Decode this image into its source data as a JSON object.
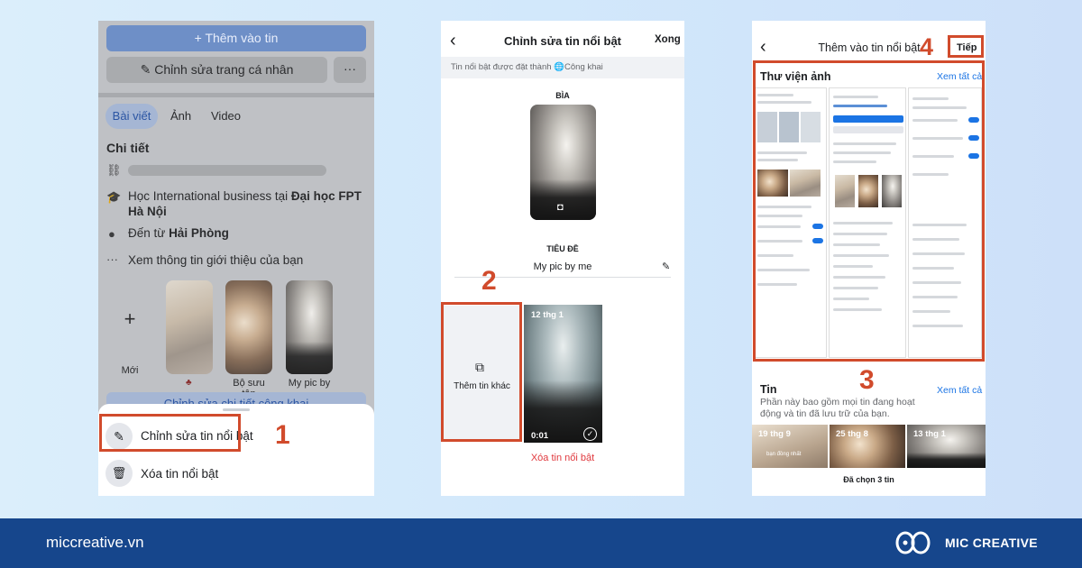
{
  "panel1": {
    "add_story_label": "Thêm vào tin",
    "edit_profile_label": "Chỉnh sửa trang cá nhân",
    "more_label": "···",
    "tabs": [
      "Bài viết",
      "Ảnh",
      "Video"
    ],
    "details_title": "Chi tiết",
    "study_prefix": "Học International business tại ",
    "study_school": "Đại học FPT Hà Nội",
    "from_prefix": "Đến từ ",
    "from_city": "Hải Phòng",
    "see_intro": "Xem thông tin giới thiệu của bạn",
    "new_label": "Mới",
    "highlights": [
      "",
      "Bộ sưu tập",
      "My pic by me"
    ],
    "edit_public_details": "Chỉnh sửa chi tiết công khai",
    "sheet": {
      "edit_highlight": "Chỉnh sửa tin nổi bật",
      "delete_highlight": "Xóa tin nổi bật"
    }
  },
  "panel2": {
    "title": "Chỉnh sửa tin nổi bật",
    "done": "Xong",
    "privacy_text": "Tin nổi bật được đặt thành",
    "privacy_value": "Công khai",
    "cover_label": "BÌA",
    "title_label": "TIÊU ĐỀ",
    "title_value": "My pic by me",
    "add_other": "Thêm tin khác",
    "story_date": "12 thg 1",
    "story_duration": "0:01",
    "delete": "Xóa tin nổi bật"
  },
  "panel3": {
    "title": "Thêm vào tin nổi bật",
    "next": "Tiếp",
    "gallery_title": "Thư viện ảnh",
    "see_all": "Xem tất cả",
    "stories_title": "Tin",
    "stories_desc": "Phần này bao gồm mọi tin đang hoạt động và tin đã lưu trữ của bạn.",
    "story_dates": [
      "19 thg 9",
      "25 thg 8",
      "13 thg 1"
    ],
    "story1_caption": "bạn đồng nhất",
    "selected": "Đã chọn 3 tin"
  },
  "steps": [
    "1",
    "2",
    "3",
    "4"
  ],
  "footer": {
    "website": "miccreative.vn",
    "brand": "MIC CREATIVE"
  },
  "colors": {
    "facebook_blue": "#1b74e4",
    "step_red": "#d14b2c",
    "footer_navy": "#16468c",
    "delete_red": "#e0393e"
  }
}
